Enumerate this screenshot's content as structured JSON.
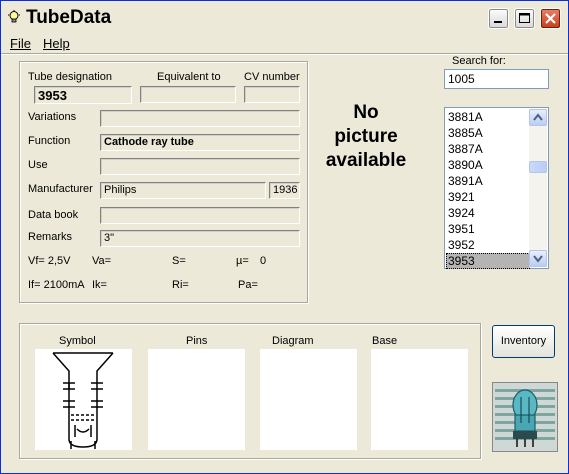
{
  "app": {
    "title": "TubeData"
  },
  "menu": {
    "file": "File",
    "help": "Help"
  },
  "labels": {
    "tube_designation": "Tube designation",
    "equivalent_to": "Equivalent to",
    "cv_number": "CV number",
    "variations": "Variations",
    "function": "Function",
    "use": "Use",
    "manufacturer": "Manufacturer",
    "data_book": "Data book",
    "remarks": "Remarks",
    "search_for": "Search for:"
  },
  "values": {
    "tube_designation": "3953",
    "equivalent_to": "",
    "cv_number": "",
    "variations": "",
    "function": "Cathode ray tube",
    "use": "",
    "manufacturer": "Philips",
    "year": "1936",
    "data_book": "",
    "remarks": "3\""
  },
  "params": {
    "vf": "Vf= 2,5V",
    "va": "Va=",
    "s": "S=",
    "mu": "µ=",
    "mu_val": "0",
    "if": "If= 2100mA",
    "ik": "Ik=",
    "ri": "Ri=",
    "pa": "Pa="
  },
  "picture": {
    "line1": "No",
    "line2": "picture",
    "line3": "available"
  },
  "search": {
    "value": "1005"
  },
  "list": {
    "items": [
      "3881A",
      "3885A",
      "3887A",
      "3890A",
      "3891A",
      "3921",
      "3924",
      "3951",
      "3952",
      "3953"
    ],
    "selected": "3953"
  },
  "bottom": {
    "symbol": "Symbol",
    "pins": "Pins",
    "diagram": "Diagram",
    "base": "Base",
    "inventory": "Inventory"
  }
}
